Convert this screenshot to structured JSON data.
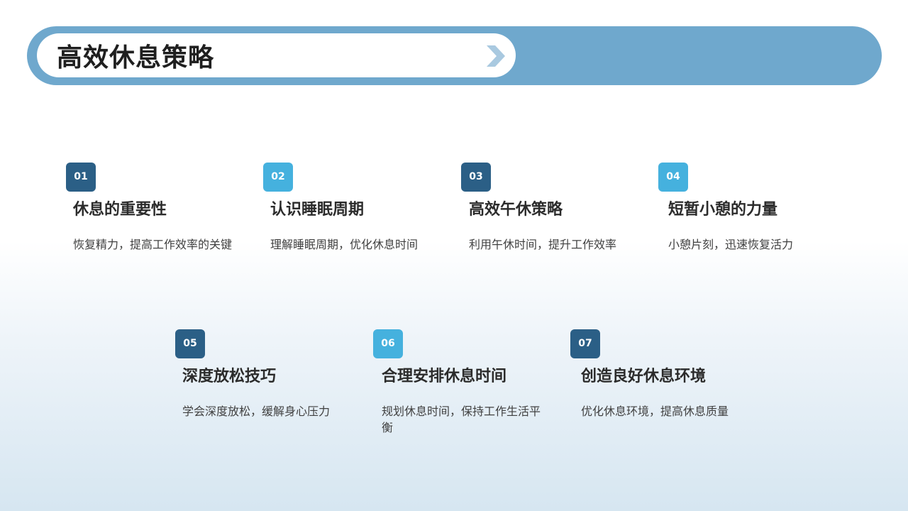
{
  "header": {
    "title": "高效休息策略"
  },
  "colors": {
    "title_bar": "#6fa8cd",
    "badge_dark": "#2b5f86",
    "badge_light": "#45b1de",
    "text_primary": "#2b2b2b",
    "text_secondary": "#404040"
  },
  "cards": [
    {
      "number": "01",
      "title": "休息的重要性",
      "description": "恢复精力，提高工作效率的关键"
    },
    {
      "number": "02",
      "title": "认识睡眠周期",
      "description": "理解睡眠周期，优化休息时间"
    },
    {
      "number": "03",
      "title": "高效午休策略",
      "description": "利用午休时间，提升工作效率"
    },
    {
      "number": "04",
      "title": "短暂小憩的力量",
      "description": "小憩片刻，迅速恢复活力"
    },
    {
      "number": "05",
      "title": "深度放松技巧",
      "description": "学会深度放松，缓解身心压力"
    },
    {
      "number": "06",
      "title": "合理安排休息时间",
      "description": "规划休息时间，保持工作生活平衡"
    },
    {
      "number": "07",
      "title": "创造良好休息环境",
      "description": "优化休息环境，提高休息质量"
    }
  ]
}
